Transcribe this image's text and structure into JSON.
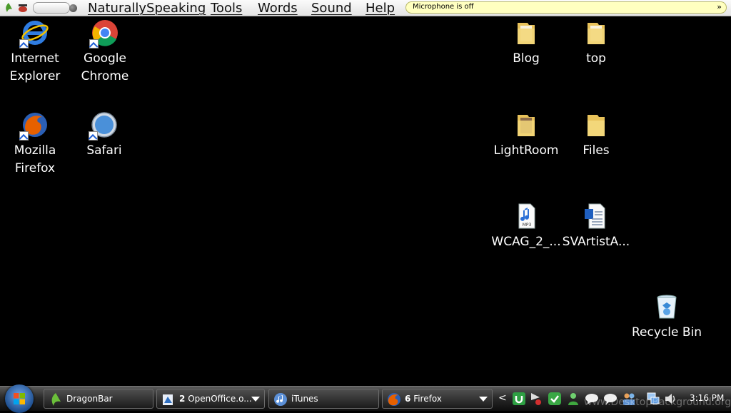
{
  "dragon_bar": {
    "menus": [
      "NaturallySpeaking",
      "Tools",
      "Words",
      "Sound",
      "Help"
    ],
    "status": "Microphone is off",
    "status_arrow": "»",
    "icons": [
      "dragon-icon",
      "microphone-icon",
      "volume-slider",
      "status-dot"
    ]
  },
  "desktop": {
    "icons": [
      {
        "label_lines": [
          "Internet",
          "Explorer"
        ],
        "icon": "internet-explorer-icon",
        "shortcut": true
      },
      {
        "label_lines": [
          "Google",
          "Chrome"
        ],
        "icon": "google-chrome-icon",
        "shortcut": true
      },
      {
        "label_lines": [
          "Mozilla",
          "Firefox"
        ],
        "icon": "firefox-icon",
        "shortcut": true
      },
      {
        "label_lines": [
          "Safari"
        ],
        "icon": "safari-icon",
        "shortcut": true
      },
      {
        "label_lines": [
          "Blog"
        ],
        "icon": "folder-icon"
      },
      {
        "label_lines": [
          "top"
        ],
        "icon": "folder-icon"
      },
      {
        "label_lines": [
          "LightRoom"
        ],
        "icon": "folder-icon"
      },
      {
        "label_lines": [
          "Files"
        ],
        "icon": "folder-icon"
      },
      {
        "label_lines": [
          "WCAG_2_..."
        ],
        "icon": "mp3-file-icon"
      },
      {
        "label_lines": [
          "SVArtistA..."
        ],
        "icon": "document-file-icon"
      },
      {
        "label_lines": [
          "Recycle Bin"
        ],
        "icon": "recycle-bin-icon"
      }
    ]
  },
  "taskbar": {
    "start_icon": "windows-start-icon",
    "buttons": [
      {
        "label": "DragonBar",
        "icon": "dragon-icon",
        "count": ""
      },
      {
        "label": "OpenOffice.o...",
        "icon": "openoffice-icon",
        "count": "2"
      },
      {
        "label": "iTunes",
        "icon": "itunes-icon",
        "count": ""
      },
      {
        "label": "Firefox",
        "icon": "firefox-icon",
        "count": "6"
      }
    ],
    "tray_chevron": "<",
    "tray_icons": [
      "utorrent-icon",
      "media-flag-icon",
      "check-icon",
      "messenger-icon",
      "chat-bubble-icon",
      "chat-bubble-icon",
      "users-icon",
      "network-icon",
      "volume-icon"
    ],
    "clock": "3:16 PM"
  },
  "watermark": "www.DesktopBackground.org"
}
